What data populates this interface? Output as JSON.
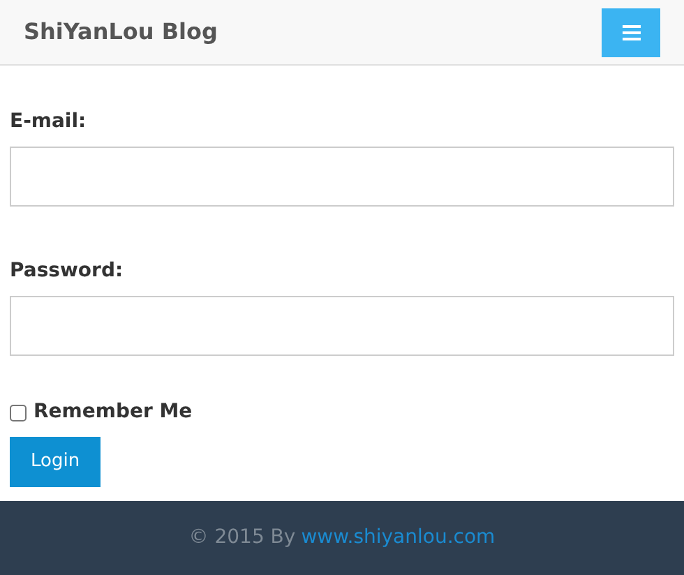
{
  "navbar": {
    "brand": "ShiYanLou Blog"
  },
  "form": {
    "fields": [
      {
        "label": "E-mail:"
      },
      {
        "label": "Password:"
      }
    ],
    "remember": {
      "label": "Remember Me",
      "checked": false
    },
    "submit": "Login"
  },
  "footer": {
    "text": "© 2015 By",
    "link": "www.shiyanlou.com"
  }
}
